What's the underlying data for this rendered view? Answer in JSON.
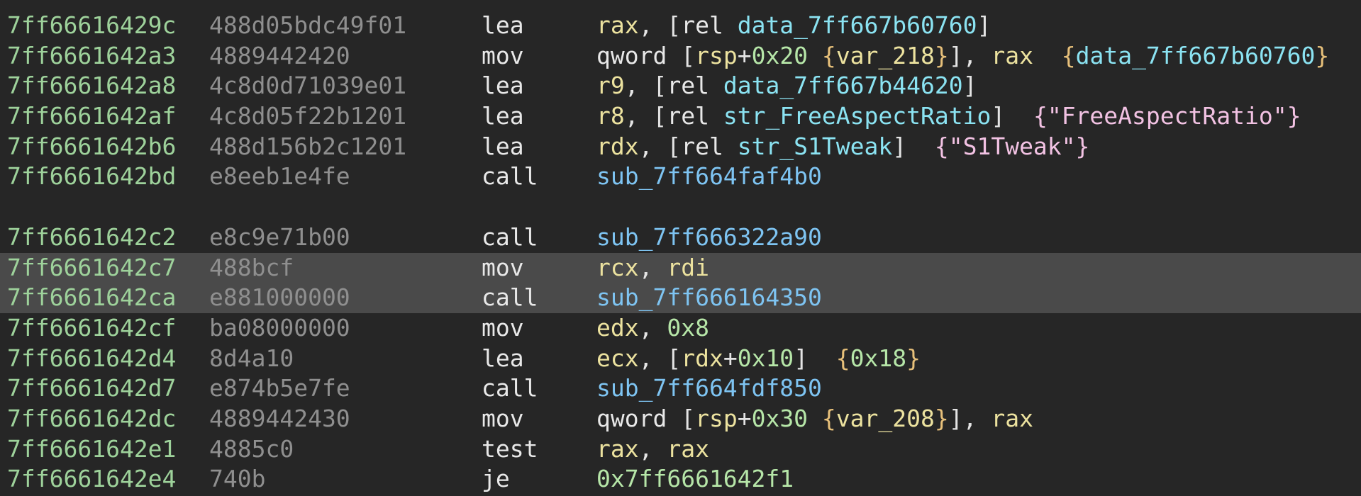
{
  "colors": {
    "background": "#262626",
    "selected_row": "#4a4a4a",
    "address": "#9ed29b",
    "bytes": "#8f8f8f",
    "mnemonic": "#e8e8e8",
    "punct": "#e4e4e4",
    "register": "#ece29f",
    "number": "#b6e6a8",
    "data_symbol": "#8be3f2",
    "func_symbol": "#7ec4f2",
    "string": "#f2c2e3",
    "variable": "#ece29f",
    "braces": "#e7c07a"
  },
  "rows": [
    {
      "address": "7ff66616429c",
      "bytes": "488d05bdc49f01",
      "mnemonic": "lea",
      "tokens": [
        {
          "text": "rax",
          "kind": "register"
        },
        {
          "text": ", [",
          "kind": "punct"
        },
        {
          "text": "rel",
          "kind": "plain"
        },
        {
          "text": " ",
          "kind": "punct"
        },
        {
          "text": "data_7ff667b60760",
          "kind": "data_symbol"
        },
        {
          "text": "]",
          "kind": "punct"
        }
      ]
    },
    {
      "address": "7ff6661642a3",
      "bytes": "4889442420",
      "mnemonic": "mov",
      "tokens": [
        {
          "text": "qword",
          "kind": "plain"
        },
        {
          "text": " [",
          "kind": "punct"
        },
        {
          "text": "rsp",
          "kind": "register"
        },
        {
          "text": "+",
          "kind": "punct"
        },
        {
          "text": "0x20",
          "kind": "number"
        },
        {
          "text": " {",
          "kind": "braces"
        },
        {
          "text": "var_218",
          "kind": "variable"
        },
        {
          "text": "}",
          "kind": "braces"
        },
        {
          "text": "], ",
          "kind": "punct"
        },
        {
          "text": "rax",
          "kind": "register"
        },
        {
          "text": "  {",
          "kind": "braces"
        },
        {
          "text": "data_7ff667b60760",
          "kind": "data_symbol"
        },
        {
          "text": "}",
          "kind": "braces"
        }
      ]
    },
    {
      "address": "7ff6661642a8",
      "bytes": "4c8d0d71039e01",
      "mnemonic": "lea",
      "tokens": [
        {
          "text": "r9",
          "kind": "register"
        },
        {
          "text": ", [",
          "kind": "punct"
        },
        {
          "text": "rel",
          "kind": "plain"
        },
        {
          "text": " ",
          "kind": "punct"
        },
        {
          "text": "data_7ff667b44620",
          "kind": "data_symbol"
        },
        {
          "text": "]",
          "kind": "punct"
        }
      ]
    },
    {
      "address": "7ff6661642af",
      "bytes": "4c8d05f22b1201",
      "mnemonic": "lea",
      "tokens": [
        {
          "text": "r8",
          "kind": "register"
        },
        {
          "text": ", [",
          "kind": "punct"
        },
        {
          "text": "rel",
          "kind": "plain"
        },
        {
          "text": " ",
          "kind": "punct"
        },
        {
          "text": "str_FreeAspectRatio",
          "kind": "data_symbol"
        },
        {
          "text": "]  ",
          "kind": "punct"
        },
        {
          "text": "{\"FreeAspectRatio\"}",
          "kind": "string"
        }
      ]
    },
    {
      "address": "7ff6661642b6",
      "bytes": "488d156b2c1201",
      "mnemonic": "lea",
      "tokens": [
        {
          "text": "rdx",
          "kind": "register"
        },
        {
          "text": ", [",
          "kind": "punct"
        },
        {
          "text": "rel",
          "kind": "plain"
        },
        {
          "text": " ",
          "kind": "punct"
        },
        {
          "text": "str_S1Tweak",
          "kind": "data_symbol"
        },
        {
          "text": "]  ",
          "kind": "punct"
        },
        {
          "text": "{\"S1Tweak\"}",
          "kind": "string"
        }
      ]
    },
    {
      "address": "7ff6661642bd",
      "bytes": "e8eeb1e4fe",
      "mnemonic": "call",
      "tokens": [
        {
          "text": "sub_7ff664faf4b0",
          "kind": "func_symbol"
        }
      ]
    },
    {
      "gap": true
    },
    {
      "address": "7ff6661642c2",
      "bytes": "e8c9e71b00",
      "mnemonic": "call",
      "tokens": [
        {
          "text": "sub_7ff666322a90",
          "kind": "func_symbol"
        }
      ]
    },
    {
      "address": "7ff6661642c7",
      "bytes": "488bcf",
      "mnemonic": "mov",
      "selected": true,
      "tokens": [
        {
          "text": "rcx",
          "kind": "register"
        },
        {
          "text": ", ",
          "kind": "punct"
        },
        {
          "text": "rdi",
          "kind": "register"
        }
      ]
    },
    {
      "address": "7ff6661642ca",
      "bytes": "e881000000",
      "mnemonic": "call",
      "selected": true,
      "tokens": [
        {
          "text": "sub_7ff666164350",
          "kind": "func_symbol"
        }
      ]
    },
    {
      "address": "7ff6661642cf",
      "bytes": "ba08000000",
      "mnemonic": "mov",
      "tokens": [
        {
          "text": "edx",
          "kind": "register"
        },
        {
          "text": ", ",
          "kind": "punct"
        },
        {
          "text": "0x8",
          "kind": "number"
        }
      ]
    },
    {
      "address": "7ff6661642d4",
      "bytes": "8d4a10",
      "mnemonic": "lea",
      "tokens": [
        {
          "text": "ecx",
          "kind": "register"
        },
        {
          "text": ", [",
          "kind": "punct"
        },
        {
          "text": "rdx",
          "kind": "register"
        },
        {
          "text": "+",
          "kind": "punct"
        },
        {
          "text": "0x10",
          "kind": "number"
        },
        {
          "text": "]  ",
          "kind": "punct"
        },
        {
          "text": "{",
          "kind": "braces"
        },
        {
          "text": "0x18",
          "kind": "number"
        },
        {
          "text": "}",
          "kind": "braces"
        }
      ]
    },
    {
      "address": "7ff6661642d7",
      "bytes": "e874b5e7fe",
      "mnemonic": "call",
      "tokens": [
        {
          "text": "sub_7ff664fdf850",
          "kind": "func_symbol"
        }
      ]
    },
    {
      "address": "7ff6661642dc",
      "bytes": "4889442430",
      "mnemonic": "mov",
      "tokens": [
        {
          "text": "qword",
          "kind": "plain"
        },
        {
          "text": " [",
          "kind": "punct"
        },
        {
          "text": "rsp",
          "kind": "register"
        },
        {
          "text": "+",
          "kind": "punct"
        },
        {
          "text": "0x30",
          "kind": "number"
        },
        {
          "text": " {",
          "kind": "braces"
        },
        {
          "text": "var_208",
          "kind": "variable"
        },
        {
          "text": "}",
          "kind": "braces"
        },
        {
          "text": "], ",
          "kind": "punct"
        },
        {
          "text": "rax",
          "kind": "register"
        }
      ]
    },
    {
      "address": "7ff6661642e1",
      "bytes": "4885c0",
      "mnemonic": "test",
      "tokens": [
        {
          "text": "rax",
          "kind": "register"
        },
        {
          "text": ", ",
          "kind": "punct"
        },
        {
          "text": "rax",
          "kind": "register"
        }
      ]
    },
    {
      "address": "7ff6661642e4",
      "bytes": "740b",
      "mnemonic": "je",
      "tokens": [
        {
          "text": "0x7ff6661642f1",
          "kind": "number"
        }
      ]
    }
  ]
}
